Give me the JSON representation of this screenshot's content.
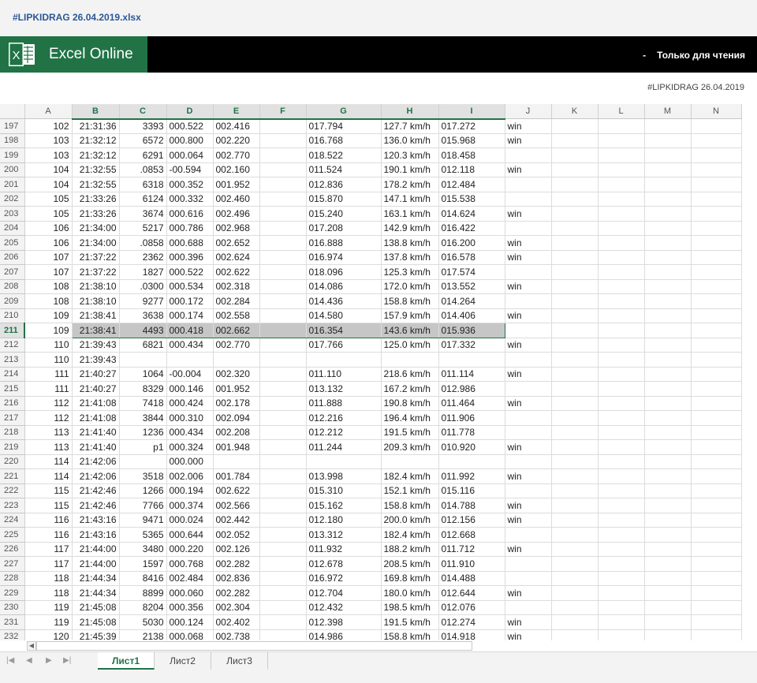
{
  "window": {
    "file_title": "#LIPKIDRAG 26.04.2019.xlsx"
  },
  "appbar": {
    "app_name": "Excel Online",
    "mode": "Только для чтения",
    "mode_dash": "-",
    "logo_letter": "X"
  },
  "doc_label": "#LIPKIDRAG 26.04.2019",
  "columns": [
    "A",
    "B",
    "C",
    "D",
    "E",
    "F",
    "G",
    "H",
    "I",
    "J",
    "K",
    "L",
    "M",
    "N"
  ],
  "selected_row": "211",
  "rows": [
    {
      "n": "197",
      "cells": [
        "102",
        "21:31:36",
        "3393",
        "000.522",
        "002.416",
        "",
        "017.794",
        "127.7 km/h",
        "017.272",
        "win"
      ]
    },
    {
      "n": "198",
      "cells": [
        "103",
        "21:32:12",
        "6572",
        "000.800",
        "002.220",
        "",
        "016.768",
        "136.0 km/h",
        "015.968",
        "win"
      ]
    },
    {
      "n": "199",
      "cells": [
        "103",
        "21:32:12",
        "6291",
        "000.064",
        "002.770",
        "",
        "018.522",
        "120.3 km/h",
        "018.458",
        ""
      ]
    },
    {
      "n": "200",
      "cells": [
        "104",
        "21:32:55",
        ".0853",
        "-00.594",
        "002.160",
        "",
        "011.524",
        "190.1 km/h",
        "012.118",
        "win"
      ]
    },
    {
      "n": "201",
      "cells": [
        "104",
        "21:32:55",
        "6318",
        "000.352",
        "001.952",
        "",
        "012.836",
        "178.2 km/h",
        "012.484",
        ""
      ]
    },
    {
      "n": "202",
      "cells": [
        "105",
        "21:33:26",
        "6124",
        "000.332",
        "002.460",
        "",
        "015.870",
        "147.1 km/h",
        "015.538",
        ""
      ]
    },
    {
      "n": "203",
      "cells": [
        "105",
        "21:33:26",
        "3674",
        "000.616",
        "002.496",
        "",
        "015.240",
        "163.1 km/h",
        "014.624",
        "win"
      ]
    },
    {
      "n": "204",
      "cells": [
        "106",
        "21:34:00",
        "5217",
        "000.786",
        "002.968",
        "",
        "017.208",
        "142.9 km/h",
        "016.422",
        ""
      ]
    },
    {
      "n": "205",
      "cells": [
        "106",
        "21:34:00",
        ".0858",
        "000.688",
        "002.652",
        "",
        "016.888",
        "138.8 km/h",
        "016.200",
        "win"
      ]
    },
    {
      "n": "206",
      "cells": [
        "107",
        "21:37:22",
        "2362",
        "000.396",
        "002.624",
        "",
        "016.974",
        "137.8 km/h",
        "016.578",
        "win"
      ]
    },
    {
      "n": "207",
      "cells": [
        "107",
        "21:37:22",
        "1827",
        "000.522",
        "002.622",
        "",
        "018.096",
        "125.3 km/h",
        "017.574",
        ""
      ]
    },
    {
      "n": "208",
      "cells": [
        "108",
        "21:38:10",
        ".0300",
        "000.534",
        "002.318",
        "",
        "014.086",
        "172.0 km/h",
        "013.552",
        "win"
      ]
    },
    {
      "n": "209",
      "cells": [
        "108",
        "21:38:10",
        "9277",
        "000.172",
        "002.284",
        "",
        "014.436",
        "158.8 km/h",
        "014.264",
        ""
      ]
    },
    {
      "n": "210",
      "cells": [
        "109",
        "21:38:41",
        "3638",
        "000.174",
        "002.558",
        "",
        "014.580",
        "157.9 km/h",
        "014.406",
        "win"
      ]
    },
    {
      "n": "211",
      "cells": [
        "109",
        "21:38:41",
        "4493",
        "000.418",
        "002.662",
        "",
        "016.354",
        "143.6 km/h",
        "015.936",
        ""
      ]
    },
    {
      "n": "212",
      "cells": [
        "110",
        "21:39:43",
        "6821",
        "000.434",
        "002.770",
        "",
        "017.766",
        "125.0 km/h",
        "017.332",
        "win"
      ]
    },
    {
      "n": "213",
      "cells": [
        "110",
        "21:39:43",
        "",
        "",
        "",
        "",
        "",
        "",
        "",
        ""
      ]
    },
    {
      "n": "214",
      "cells": [
        "111",
        "21:40:27",
        "1064",
        "-00.004",
        "002.320",
        "",
        "011.110",
        "218.6 km/h",
        "011.114",
        "win"
      ]
    },
    {
      "n": "215",
      "cells": [
        "111",
        "21:40:27",
        "8329",
        "000.146",
        "001.952",
        "",
        "013.132",
        "167.2 km/h",
        "012.986",
        ""
      ]
    },
    {
      "n": "216",
      "cells": [
        "112",
        "21:41:08",
        "7418",
        "000.424",
        "002.178",
        "",
        "011.888",
        "190.8 km/h",
        "011.464",
        "win"
      ]
    },
    {
      "n": "217",
      "cells": [
        "112",
        "21:41:08",
        "3844",
        "000.310",
        "002.094",
        "",
        "012.216",
        "196.4 km/h",
        "011.906",
        ""
      ]
    },
    {
      "n": "218",
      "cells": [
        "113",
        "21:41:40",
        "1236",
        "000.434",
        "002.208",
        "",
        "012.212",
        "191.5 km/h",
        "011.778",
        ""
      ]
    },
    {
      "n": "219",
      "cells": [
        "113",
        "21:41:40",
        "p1",
        "000.324",
        "001.948",
        "",
        "011.244",
        "209.3 km/h",
        "010.920",
        "win"
      ]
    },
    {
      "n": "220",
      "cells": [
        "114",
        "21:42:06",
        "",
        "000.000",
        "",
        "",
        "",
        "",
        "",
        ""
      ]
    },
    {
      "n": "221",
      "cells": [
        "114",
        "21:42:06",
        "3518",
        "002.006",
        "001.784",
        "",
        "013.998",
        "182.4 km/h",
        "011.992",
        "win"
      ]
    },
    {
      "n": "222",
      "cells": [
        "115",
        "21:42:46",
        "1266",
        "000.194",
        "002.622",
        "",
        "015.310",
        "152.1 km/h",
        "015.116",
        ""
      ]
    },
    {
      "n": "223",
      "cells": [
        "115",
        "21:42:46",
        "7766",
        "000.374",
        "002.566",
        "",
        "015.162",
        "158.8 km/h",
        "014.788",
        "win"
      ]
    },
    {
      "n": "224",
      "cells": [
        "116",
        "21:43:16",
        "9471",
        "000.024",
        "002.442",
        "",
        "012.180",
        "200.0 km/h",
        "012.156",
        "win"
      ]
    },
    {
      "n": "225",
      "cells": [
        "116",
        "21:43:16",
        "5365",
        "000.644",
        "002.052",
        "",
        "013.312",
        "182.4 km/h",
        "012.668",
        ""
      ]
    },
    {
      "n": "226",
      "cells": [
        "117",
        "21:44:00",
        "3480",
        "000.220",
        "002.126",
        "",
        "011.932",
        "188.2 km/h",
        "011.712",
        "win"
      ]
    },
    {
      "n": "227",
      "cells": [
        "117",
        "21:44:00",
        "1597",
        "000.768",
        "002.282",
        "",
        "012.678",
        "208.5 km/h",
        "011.910",
        ""
      ]
    },
    {
      "n": "228",
      "cells": [
        "118",
        "21:44:34",
        "8416",
        "002.484",
        "002.836",
        "",
        "016.972",
        "169.8 km/h",
        "014.488",
        ""
      ]
    },
    {
      "n": "229",
      "cells": [
        "118",
        "21:44:34",
        "8899",
        "000.060",
        "002.282",
        "",
        "012.704",
        "180.0 km/h",
        "012.644",
        "win"
      ]
    },
    {
      "n": "230",
      "cells": [
        "119",
        "21:45:08",
        "8204",
        "000.356",
        "002.304",
        "",
        "012.432",
        "198.5 km/h",
        "012.076",
        ""
      ]
    },
    {
      "n": "231",
      "cells": [
        "119",
        "21:45:08",
        "5030",
        "000.124",
        "002.402",
        "",
        "012.398",
        "191.5 km/h",
        "012.274",
        "win"
      ]
    },
    {
      "n": "232",
      "cells": [
        "120",
        "21:45:39",
        "2138",
        "000.068",
        "002.738",
        "",
        "014.986",
        "158.8 km/h",
        "014.918",
        "win"
      ]
    }
  ],
  "sheets": [
    {
      "label": "Лист1",
      "active": true
    },
    {
      "label": "Лист2",
      "active": false
    },
    {
      "label": "Лист3",
      "active": false
    }
  ],
  "nav_icons": [
    "first-sheet-icon",
    "prev-sheet-icon",
    "next-sheet-icon",
    "last-sheet-icon"
  ],
  "colors": {
    "brand": "#217346",
    "bar": "#000000",
    "title": "#2b5797",
    "selected_fill": "#c6c6c6"
  }
}
